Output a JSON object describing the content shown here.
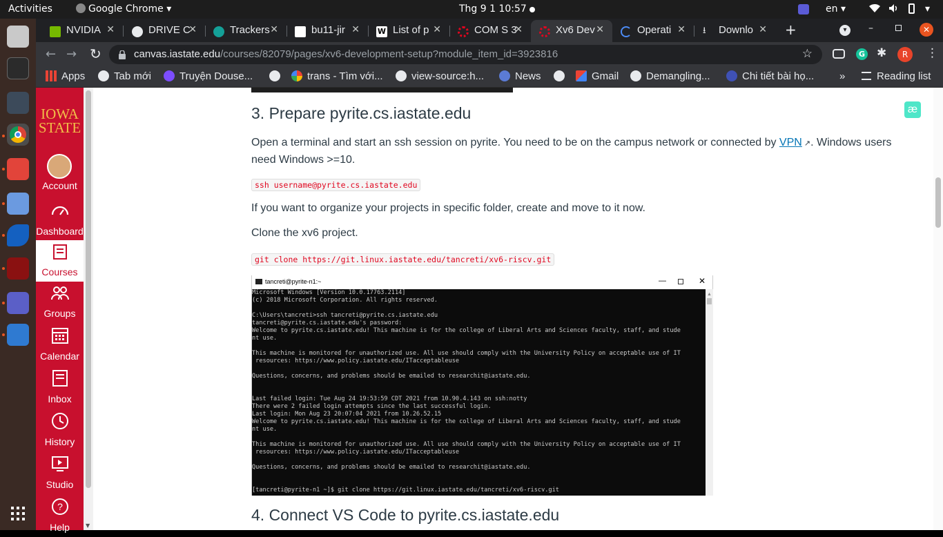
{
  "topbar": {
    "activities": "Activities",
    "app": "Google Chrome",
    "clock": "Thg 9 1  10:57",
    "lang": "en"
  },
  "tabs": [
    {
      "title": "NVIDIA",
      "color": "#76b900"
    },
    {
      "title": "DRIVE C",
      "color": "#e8eaed"
    },
    {
      "title": "Trackers",
      "color": "#14a098"
    },
    {
      "title": "bu11-jir",
      "color": "#ffffff"
    },
    {
      "title": "List of p",
      "color": "#ffffff"
    },
    {
      "title": "COM S 3",
      "color": "#e0061f"
    },
    {
      "title": "Xv6 Dev",
      "color": "#e0061f"
    },
    {
      "title": "Operati",
      "color": "#4c8bf5"
    },
    {
      "title": "Downlo",
      "color": "#e8eaed"
    }
  ],
  "address": {
    "host": "canvas.iastate.edu",
    "path": "/courses/82079/pages/xv6-development-setup?module_item_id=3923816"
  },
  "bookmarks": [
    "Apps",
    "Tab mới",
    "Truyện Douse...",
    "trans - Tìm với...",
    "view-source:h...",
    "News",
    "Gmail",
    "Demangling...",
    "Chi tiết bài họ...",
    "Reading list"
  ],
  "canvas_nav": {
    "logo_line1": "IOWA",
    "logo_line2": "STATE",
    "items": [
      "Account",
      "Dashboard",
      "Courses",
      "Groups",
      "Calendar",
      "Inbox",
      "History",
      "Studio",
      "Help"
    ]
  },
  "content": {
    "heading3": "3. Prepare pyrite.cs.iastate.edu",
    "para1_a": "Open a terminal and start an ssh session on pyrite. You need to be on the campus network or connected by ",
    "para1_link": "VPN",
    "para1_b": ". Windows users need Windows >=10.",
    "code1": "ssh username@pyrite.cs.iastate.edu",
    "para2": "If you want to organize your projects in specific folder, create and move to it now.",
    "para3": "Clone the xv6 project.",
    "code2": "git clone https://git.linux.iastate.edu/tancreti/xv6-riscv.git",
    "heading4": "4. Connect VS Code to pyrite.cs.iastate.edu"
  },
  "terminal": {
    "title": "tancreti@pyrite-n1:~",
    "lines": [
      "Microsoft Windows [Version 10.0.17763.2114]",
      "(c) 2018 Microsoft Corporation. All rights reserved.",
      "",
      "C:\\Users\\tancreti>ssh tancreti@pyrite.cs.iastate.edu",
      "tancreti@pyrite.cs.iastate.edu's password:",
      "Welcome to pyrite.cs.iastate.edu! This machine is for the college of Liberal Arts and Sciences faculty, staff, and stude",
      "nt use.",
      "",
      "This machine is monitored for unauthorized use. All use should comply with the University Policy on acceptable use of IT",
      " resources: https://www.policy.iastate.edu/ITacceptableuse",
      "",
      "Questions, concerns, and problems should be emailed to researchit@iastate.edu.",
      "",
      "",
      "Last failed login: Tue Aug 24 19:53:59 CDT 2021 from 10.90.4.143 on ssh:notty",
      "There were 2 failed login attempts since the last successful login.",
      "Last login: Mon Aug 23 20:07:04 2021 from 10.26.52.15",
      "Welcome to pyrite.cs.iastate.edu! This machine is for the college of Liberal Arts and Sciences faculty, staff, and stude",
      "nt use.",
      "",
      "This machine is monitored for unauthorized use. All use should comply with the University Policy on acceptable use of IT",
      " resources: https://www.policy.iastate.edu/ITacceptableuse",
      "",
      "Questions, concerns, and problems should be emailed to researchit@iastate.edu.",
      "",
      "",
      "[tancreti@pyrite-n1 ~]$ git clone https://git.linux.iastate.edu/tancreti/xv6-riscv.git"
    ]
  },
  "extension_badge": "æ",
  "profile_initial": "R"
}
